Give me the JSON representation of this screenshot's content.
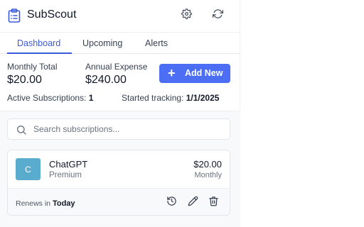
{
  "app": {
    "title": "SubScout",
    "logo_icon": "clipboard-list-icon",
    "settings_icon": "gear-icon",
    "refresh_icon": "refresh-icon"
  },
  "tabs": [
    {
      "label": "Dashboard",
      "active": true
    },
    {
      "label": "Upcoming",
      "active": false
    },
    {
      "label": "Alerts",
      "active": false
    }
  ],
  "summary": {
    "monthly_label": "Monthly Total",
    "monthly_value": "$20.00",
    "annual_label": "Annual Expense",
    "annual_value": "$240.00",
    "add_button": "Add New",
    "active_label": "Active Subscriptions:",
    "active_count": "1",
    "tracking_label": "Started tracking:",
    "tracking_date": "1/1/2025"
  },
  "search": {
    "placeholder": "Search subscriptions...",
    "value": ""
  },
  "subscriptions": [
    {
      "initial": "C",
      "name": "ChatGPT",
      "plan": "Premium",
      "price": "$20.00",
      "cycle": "Monthly",
      "renews_label": "Renews in",
      "renews_value": "Today",
      "avatar_color": "#5aaccf"
    }
  ],
  "colors": {
    "accent": "#4c6ef5",
    "tab_active": "#3b5bdb"
  }
}
